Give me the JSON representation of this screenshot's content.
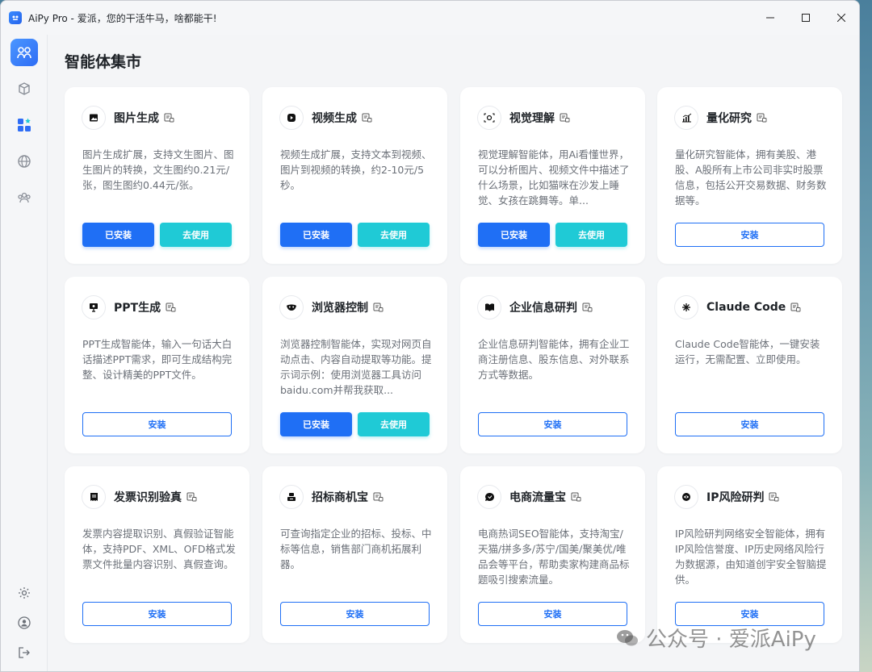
{
  "window": {
    "title": "AiPy Pro - 爱派，您的干活牛马，啥都能干!"
  },
  "page": {
    "title": "智能体集市"
  },
  "labels": {
    "installed": "已安装",
    "use": "去使用",
    "install": "安装"
  },
  "cards": [
    {
      "name": "图片生成",
      "icon": "image-icon",
      "desc": "图片生成扩展，支持文生图片、图生图片的转换，文生图约0.21元/张，图生图约0.44元/张。",
      "installed": true
    },
    {
      "name": "视频生成",
      "icon": "video-icon",
      "desc": "视频生成扩展，支持文本到视频、图片到视频的转换，约2-10元/5秒。",
      "installed": true
    },
    {
      "name": "视觉理解",
      "icon": "eye-icon",
      "desc": "视觉理解智能体，用Ai看懂世界，可以分析图片、视频文件中描述了什么场景，比如猫咪在沙发上睡觉、女孩在跳舞等。单...",
      "installed": true
    },
    {
      "name": "量化研究",
      "icon": "chart-icon",
      "desc": "量化研究智能体，拥有美股、港股、A股所有上市公司非实时股票信息，包括公开交易数据、财务数据等。",
      "installed": false
    },
    {
      "name": "PPT生成",
      "icon": "presentation-icon",
      "desc": "PPT生成智能体，输入一句话大白话描述PPT需求，即可生成结构完整、设计精美的PPT文件。",
      "installed": false
    },
    {
      "name": "浏览器控制",
      "icon": "browser-icon",
      "desc": "浏览器控制智能体，实现对网页自动点击、内容自动提取等功能。提示词示例：使用浏览器工具访问baidu.com并帮我获取...",
      "installed": true
    },
    {
      "name": "企业信息研判",
      "icon": "book-icon",
      "desc": "企业信息研判智能体，拥有企业工商注册信息、股东信息、对外联系方式等数据。",
      "installed": false
    },
    {
      "name": "Claude Code",
      "icon": "claude-icon",
      "desc": "Claude Code智能体，一键安装运行，无需配置、立即使用。",
      "installed": false
    },
    {
      "name": "发票识别验真",
      "icon": "invoice-icon",
      "desc": "发票内容提取识别、真假验证智能体，支持PDF、XML、OFD格式发票文件批量内容识别、真假查询。",
      "installed": false
    },
    {
      "name": "招标商机宝",
      "icon": "bid-icon",
      "desc": "可查询指定企业的招标、投标、中标等信息，销售部门商机拓展利器。",
      "installed": false
    },
    {
      "name": "电商流量宝",
      "icon": "ecommerce-icon",
      "desc": "电商热词SEO智能体，支持淘宝/天猫/拼多多/苏宁/国美/聚美优/唯品会等平台，帮助卖家构建商品标题吸引搜索流量。",
      "installed": false
    },
    {
      "name": "IP风险研判",
      "icon": "shield-icon",
      "desc": "IP风险研判网络安全智能体，拥有IP风险信誉度、IP历史网络风险行为数据源，由知道创宇安全智脑提供。",
      "installed": false
    }
  ],
  "watermark": {
    "text": "公众号 · 爱派AiPy"
  }
}
